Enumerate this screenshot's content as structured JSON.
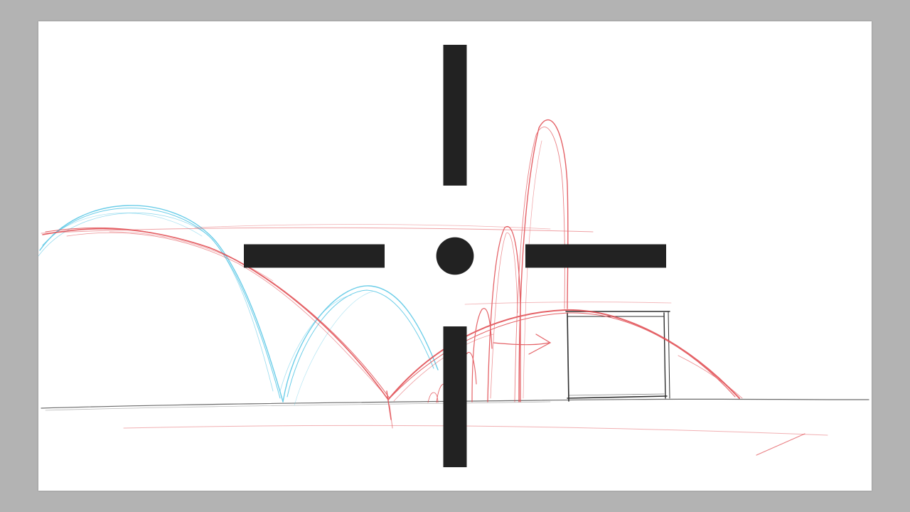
{
  "workspace": {
    "background_color": "#b3b3b3"
  },
  "canvas": {
    "background_color": "#ffffff"
  },
  "sketch": {
    "layers": [
      {
        "name": "bounce-arcs-blue",
        "stroke_color": "#5cc8e6"
      },
      {
        "name": "bounce-arcs-red",
        "stroke_color": "#e0464c"
      },
      {
        "name": "ground-and-box-graphite",
        "stroke_color": "#3a3a3a"
      }
    ]
  },
  "cursor": {
    "icon": "crosshair-cursor-icon"
  }
}
